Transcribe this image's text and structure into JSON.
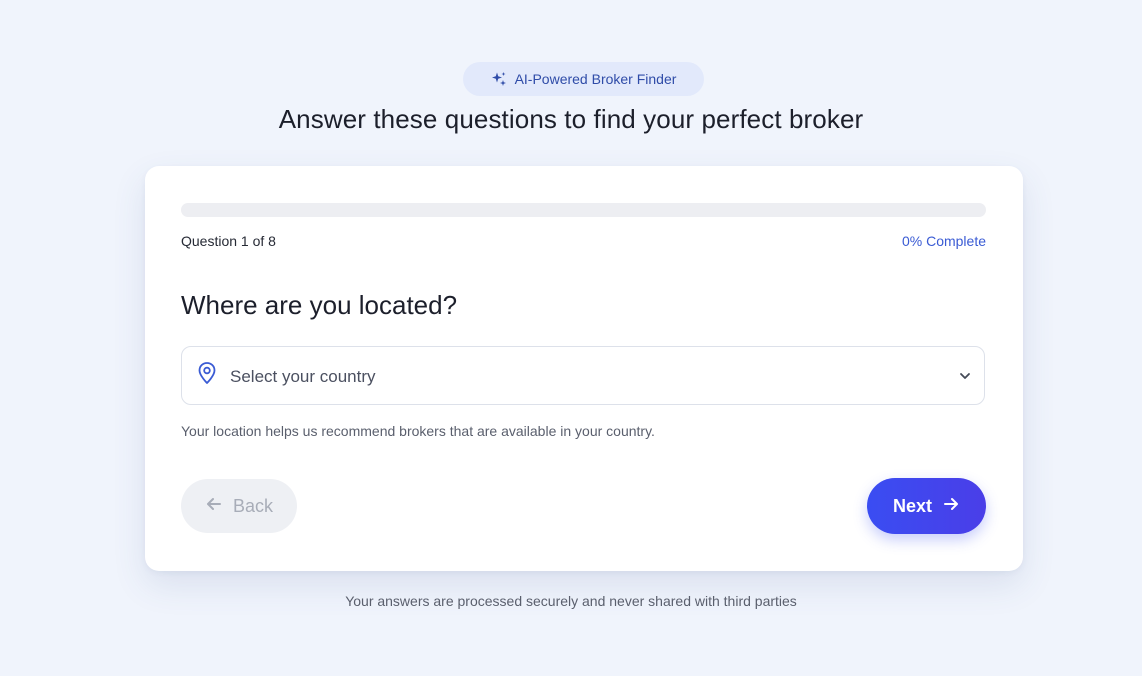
{
  "badge": {
    "icon": "sparkles-icon",
    "label": "AI-Powered Broker Finder"
  },
  "page_title": "Answer these questions to find your perfect broker",
  "progress": {
    "question_label": "Question 1 of 8",
    "complete_label": "0% Complete",
    "percent": 0
  },
  "question": {
    "title": "Where are you located?",
    "select": {
      "icon": "map-pin-icon",
      "placeholder": "Select your country",
      "chevron_icon": "chevron-down-icon"
    },
    "help_text": "Your location helps us recommend brokers that are available in your country."
  },
  "buttons": {
    "back_label": "Back",
    "next_label": "Next"
  },
  "footer_note": "Your answers are processed securely and never shared with third parties",
  "colors": {
    "accent": "#3b4ff0",
    "background": "#f0f4fc",
    "badge_bg": "#e2e9fb",
    "complete_text": "#3a5bd4"
  }
}
